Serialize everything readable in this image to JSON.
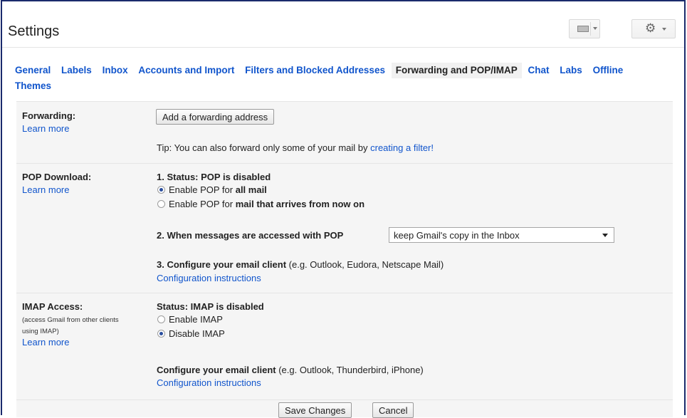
{
  "header": {
    "title": "Settings",
    "icons": {
      "keyboard": "keyboard-icon",
      "settings": "gear-icon"
    }
  },
  "tabs": [
    {
      "label": "General",
      "active": false
    },
    {
      "label": "Labels",
      "active": false
    },
    {
      "label": "Inbox",
      "active": false
    },
    {
      "label": "Accounts and Import",
      "active": false
    },
    {
      "label": "Filters and Blocked Addresses",
      "active": false
    },
    {
      "label": "Forwarding and POP/IMAP",
      "active": true
    },
    {
      "label": "Chat",
      "active": false
    },
    {
      "label": "Labs",
      "active": false
    },
    {
      "label": "Offline",
      "active": false
    },
    {
      "label": "Themes",
      "active": false
    }
  ],
  "forwarding": {
    "label": "Forwarding:",
    "learn_more": "Learn more",
    "add_button": "Add a forwarding address",
    "tip_prefix": "Tip: You can also forward only some of your mail by ",
    "tip_link": "creating a filter!"
  },
  "pop": {
    "label": "POP Download:",
    "learn_more": "Learn more",
    "status": "1. Status: POP is disabled",
    "option1_prefix": "Enable POP for ",
    "option1_bold": "all mail",
    "option1_checked": true,
    "option2_prefix": "Enable POP for ",
    "option2_bold": "mail that arrives from now on",
    "option2_checked": false,
    "when_label": "2. When messages are accessed with POP",
    "when_selected": "keep Gmail's copy in the Inbox",
    "configure_bold": "3. Configure your email client",
    "configure_rest": " (e.g. Outlook, Eudora, Netscape Mail)",
    "config_link": "Configuration instructions"
  },
  "imap": {
    "label": "IMAP Access:",
    "sub_line1": "(access Gmail from other clients",
    "sub_line2": "using IMAP)",
    "learn_more": "Learn more",
    "status": "Status: IMAP is disabled",
    "enable_label": "Enable IMAP",
    "enable_checked": false,
    "disable_label": "Disable IMAP",
    "disable_checked": true,
    "configure_bold": "Configure your email client",
    "configure_rest": " (e.g. Outlook, Thunderbird, iPhone)",
    "config_link": "Configuration instructions"
  },
  "actions": {
    "save": "Save Changes",
    "cancel": "Cancel"
  },
  "colors": {
    "link": "#1155cc",
    "frame_border": "#1a2a6c",
    "panel_bg": "#f5f5f5",
    "radio_on": "#2a4e9e"
  }
}
